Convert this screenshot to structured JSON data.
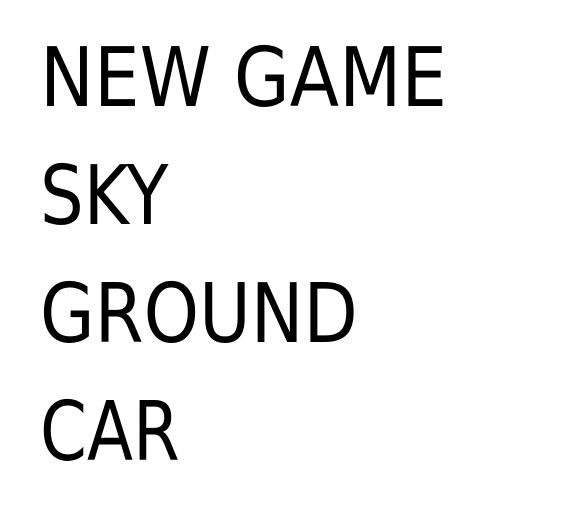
{
  "menu": {
    "items": [
      {
        "label": "NEW GAME"
      },
      {
        "label": "SKY"
      },
      {
        "label": "GROUND"
      },
      {
        "label": "CAR"
      }
    ]
  }
}
